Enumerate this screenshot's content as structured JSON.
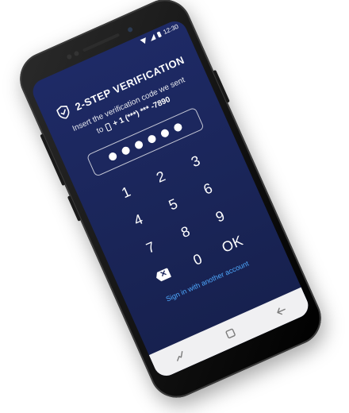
{
  "status_bar": {
    "time": "12:30",
    "icons": [
      "wifi-icon",
      "signal-icon",
      "battery-icon"
    ]
  },
  "verification": {
    "title": "2-STEP VERIFICATION",
    "instruction": "Insert the verification code we sent",
    "to_label": "to",
    "phone_number": "+ 1 (***) *** -7890",
    "code_length": 6,
    "entered_digits": 6
  },
  "keypad": {
    "keys": [
      "1",
      "2",
      "3",
      "4",
      "5",
      "6",
      "7",
      "8",
      "9",
      "",
      "0",
      "OK"
    ],
    "backspace_icon": "backspace-icon",
    "ok_label": "OK"
  },
  "link": {
    "label": "Sign in with another account"
  },
  "nav_bar": {
    "buttons": [
      "recent-apps-icon",
      "home-icon",
      "back-icon"
    ]
  },
  "colors": {
    "screen_bg": "#1e2a66",
    "link": "#4ea9ff",
    "nav_bg": "#f0f0f2"
  }
}
